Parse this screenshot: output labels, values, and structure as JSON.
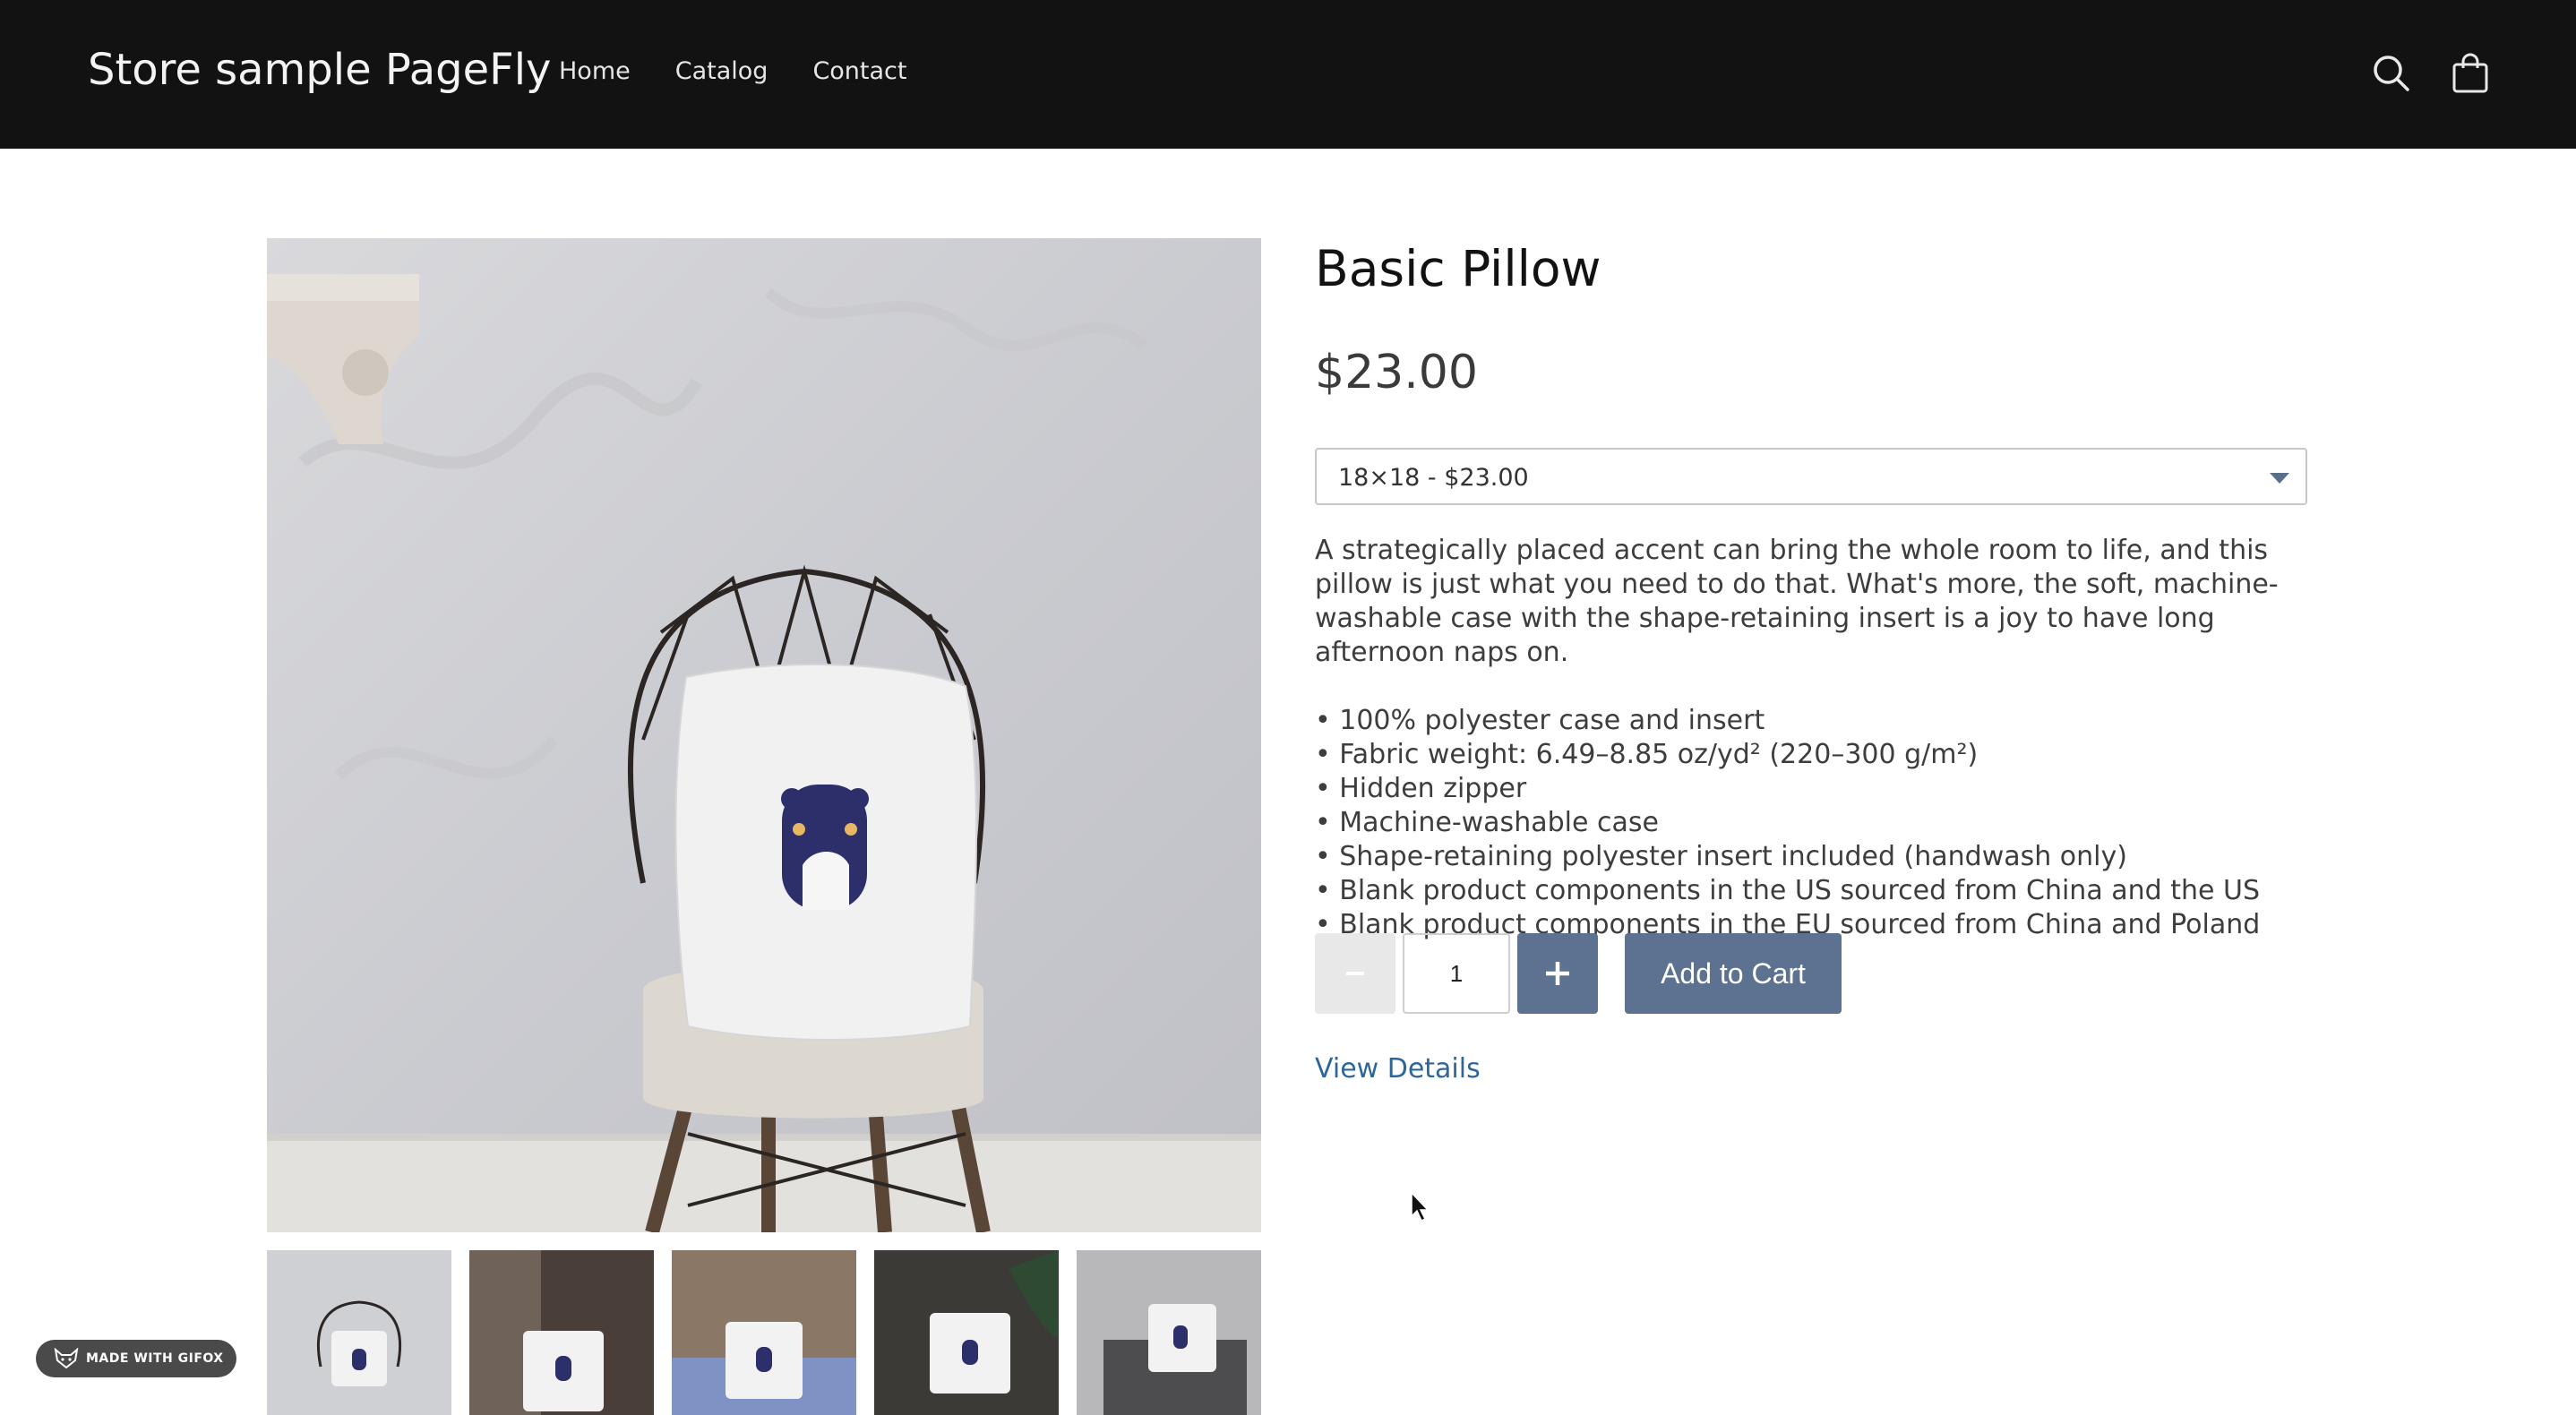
{
  "header": {
    "store_title": "Store sample PageFly",
    "nav": [
      "Home",
      "Catalog",
      "Contact"
    ],
    "icons": [
      "search-icon",
      "cart-icon"
    ]
  },
  "product": {
    "title": "Basic Pillow",
    "price": "$23.00",
    "variant_selected": "18×18 - $23.00",
    "description": "A strategically placed accent can bring the whole room to life, and this pillow is just what you need to do that. What's more, the soft, machine-washable case with the shape-retaining insert is a joy to have long afternoon naps on.",
    "features": [
      "• 100% polyester case and insert",
      "• Fabric weight: 6.49–8.85 oz/yd² (220–300 g/m²)",
      "• Hidden zipper",
      "• Machine-washable case",
      "• Shape-retaining polyester insert included (handwash only)",
      "• Blank product components in the US sourced from China and the US",
      "• Blank product components in the EU sourced from China and Poland"
    ],
    "quantity": "1",
    "add_to_cart_label": "Add to Cart",
    "view_details_label": "View Details",
    "thumbnails": 5
  },
  "badge": {
    "label": "MADE WITH GIFOX"
  },
  "colors": {
    "header_bg": "#121212",
    "button_blue": "#5c7290",
    "link_blue": "#2e6699"
  }
}
